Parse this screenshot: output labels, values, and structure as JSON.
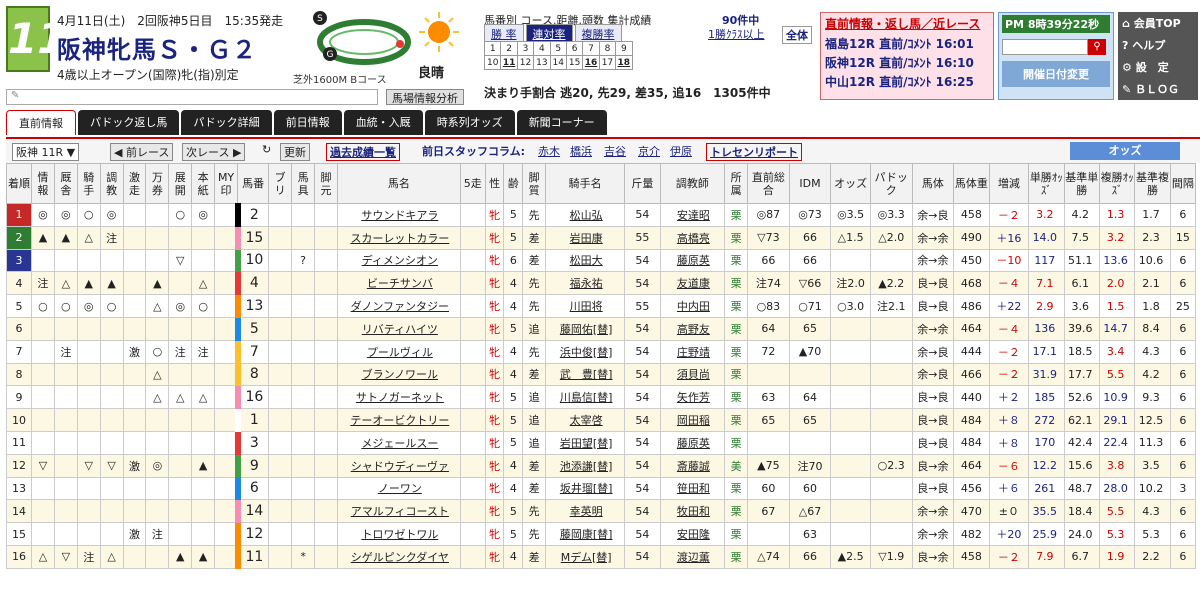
{
  "header": {
    "race_no": "11",
    "date": "4月11日(土)　2回阪神5日目　15:35発走",
    "race_name": "阪神牝馬Ｓ・Ｇ２",
    "condition": "4歳以上オープン(国際)牝(指)別定",
    "course": "芝外1600M",
    "course_sub": "Bコース",
    "weather": "良晴"
  },
  "stats": {
    "label": "馬番別 コース.距離.頭数 集計成績",
    "count": "90件中",
    "tabs": [
      "勝 率",
      "連対率",
      "複勝率"
    ],
    "active_tab": 1,
    "class_link": "1勝ｸﾗｽ以上",
    "all_label": "全体",
    "numbers": [
      "1",
      "2",
      "3",
      "4",
      "5",
      "6",
      "7",
      "8",
      "9",
      "10",
      "11",
      "12",
      "13",
      "14",
      "15",
      "16",
      "17",
      "18"
    ],
    "winning": "決まり手割合 逃20, 先29, 差35, 追16　1305件中"
  },
  "notice": {
    "head": "直前情報・返し馬／近レース",
    "lines": [
      "福島12R 直前/ｺﾒﾝﾄ 16:01",
      "阪神12R 直前/ｺﾒﾝﾄ 16:10",
      "中山12R 直前/ｺﾒﾝﾄ 16:25"
    ]
  },
  "clock": {
    "time": "PM 8時39分22秒",
    "date_btn": "開催日付変更"
  },
  "menu": [
    "会員TOP",
    "ヘルプ",
    "設　定",
    "ＢＬＯＧ"
  ],
  "baba_btn": "馬場情報分析",
  "nav_tabs": [
    "直前情報",
    "パドック返し馬",
    "パドック詳細",
    "前日情報",
    "血統・入厩",
    "時系列オッズ",
    "新聞コーナー"
  ],
  "toolbar": {
    "race_select": "阪神 11R",
    "prev": "前レース",
    "next": "次レース",
    "refresh": "更新",
    "past": "過去成績一覧",
    "staff": "前日スタッフコラム:",
    "staff_names": [
      "赤木",
      "橋浜",
      "吉谷",
      "京介",
      "伊原"
    ],
    "trecen": "トレセンリポート",
    "odds": "オッズ"
  },
  "columns": [
    "着順",
    "情報",
    "厩舎",
    "騎手",
    "調教",
    "激走",
    "万券",
    "展開",
    "本紙",
    "MY印",
    "馬番",
    "ブリ",
    "馬具",
    "脚元",
    "馬名",
    "5走",
    "性",
    "齢",
    "脚質",
    "騎手名",
    "斤量",
    "調教師",
    "所属",
    "直前総合",
    "IDM",
    "オッズ",
    "パドック",
    "馬体",
    "馬体重",
    "増減",
    "単勝ｵｯｽﾞ",
    "基準単勝",
    "複勝ｵｯｽﾞ",
    "基準複勝",
    "間隔"
  ],
  "rows": [
    [
      "1",
      "◎",
      "◎",
      "○",
      "◎",
      "",
      "",
      "○",
      "◎",
      "",
      "2",
      "",
      "",
      "",
      "サウンドキアラ",
      "",
      "牝",
      "5",
      "先",
      "松山弘",
      "54",
      "安達昭",
      "栗",
      "◎87",
      "◎73",
      "◎3.5",
      "◎3.3",
      "余→良",
      "458",
      "－２",
      "3.2",
      "4.2",
      "1.3",
      "1.7",
      "6"
    ],
    [
      "2",
      "▲",
      "▲",
      "△",
      "注",
      "",
      "",
      "",
      "",
      "",
      "15",
      "",
      "",
      "",
      "スカーレットカラー",
      "",
      "牝",
      "5",
      "差",
      "岩田康",
      "55",
      "高橋亮",
      "栗",
      "▽73",
      "66",
      "△1.5",
      "△2.0",
      "余→余",
      "490",
      "＋16",
      "14.0",
      "7.5",
      "3.2",
      "2.3",
      "15"
    ],
    [
      "3",
      "",
      "",
      "",
      "",
      "",
      "",
      "▽",
      "",
      "",
      "10",
      "",
      "?",
      "",
      "ディメンシオン",
      "",
      "牝",
      "6",
      "差",
      "松田大",
      "54",
      "藤原英",
      "栗",
      "66",
      "66",
      "",
      "",
      "余→余",
      "450",
      "－10",
      "117",
      "51.1",
      "13.6",
      "10.6",
      "6"
    ],
    [
      "4",
      "注",
      "△",
      "▲",
      "▲",
      "",
      "▲",
      "",
      "△",
      "",
      "4",
      "",
      "",
      "",
      "ビーチサンバ",
      "",
      "牝",
      "4",
      "先",
      "福永祐",
      "54",
      "友道康",
      "栗",
      "注74",
      "▽66",
      "注2.0",
      "▲2.2",
      "良→良",
      "468",
      "－４",
      "7.1",
      "6.1",
      "2.0",
      "2.1",
      "6"
    ],
    [
      "5",
      "○",
      "○",
      "◎",
      "○",
      "",
      "△",
      "◎",
      "○",
      "",
      "13",
      "",
      "",
      "",
      "ダノンファンタジー",
      "",
      "牝",
      "4",
      "先",
      "川田将",
      "55",
      "中内田",
      "栗",
      "○83",
      "○71",
      "○3.0",
      "注2.1",
      "良→良",
      "486",
      "＋22",
      "2.9",
      "3.6",
      "1.5",
      "1.8",
      "25"
    ],
    [
      "6",
      "",
      "",
      "",
      "",
      "",
      "",
      "",
      "",
      "",
      "5",
      "",
      "",
      "",
      "リバティハイツ",
      "",
      "牝",
      "5",
      "追",
      "藤岡佑[替]",
      "54",
      "高野友",
      "栗",
      "64",
      "65",
      "",
      "",
      "余→余",
      "464",
      "－４",
      "136",
      "39.6",
      "14.7",
      "8.4",
      "6"
    ],
    [
      "7",
      "",
      "注",
      "",
      "",
      "激",
      "○",
      "注",
      "注",
      "",
      "7",
      "",
      "",
      "",
      "プールヴィル",
      "",
      "牝",
      "4",
      "先",
      "浜中俊[替]",
      "54",
      "庄野靖",
      "栗",
      "72",
      "▲70",
      "",
      "",
      "余→良",
      "444",
      "－２",
      "17.1",
      "18.5",
      "3.4",
      "4.3",
      "6"
    ],
    [
      "8",
      "",
      "",
      "",
      "",
      "",
      "△",
      "",
      "",
      "",
      "8",
      "",
      "",
      "",
      "ブランノワール",
      "",
      "牝",
      "4",
      "差",
      "武　豊[替]",
      "54",
      "須貝尚",
      "栗",
      "",
      "",
      "",
      "",
      "余→良",
      "466",
      "－２",
      "31.9",
      "17.7",
      "5.5",
      "4.2",
      "6"
    ],
    [
      "9",
      "",
      "",
      "",
      "",
      "",
      "△",
      "△",
      "△",
      "",
      "16",
      "",
      "",
      "",
      "サトノガーネット",
      "",
      "牝",
      "5",
      "追",
      "川島信[替]",
      "54",
      "矢作芳",
      "栗",
      "63",
      "64",
      "",
      "",
      "良→良",
      "440",
      "＋２",
      "185",
      "52.6",
      "10.9",
      "9.3",
      "6"
    ],
    [
      "10",
      "",
      "",
      "",
      "",
      "",
      "",
      "",
      "",
      "",
      "1",
      "",
      "",
      "",
      "テーオービクトリー",
      "",
      "牝",
      "5",
      "追",
      "太宰啓",
      "54",
      "岡田稲",
      "栗",
      "65",
      "65",
      "",
      "",
      "良→良",
      "484",
      "＋８",
      "272",
      "62.1",
      "29.1",
      "12.5",
      "6"
    ],
    [
      "11",
      "",
      "",
      "",
      "",
      "",
      "",
      "",
      "",
      "",
      "3",
      "",
      "",
      "",
      "メジェールスー",
      "",
      "牝",
      "5",
      "追",
      "岩田望[替]",
      "54",
      "藤原英",
      "栗",
      "",
      "",
      "",
      "",
      "良→良",
      "484",
      "＋８",
      "170",
      "42.4",
      "22.4",
      "11.3",
      "6"
    ],
    [
      "12",
      "▽",
      "",
      "▽",
      "▽",
      "激",
      "◎",
      "",
      "▲",
      "",
      "9",
      "",
      "",
      "",
      "シャドウディーヴァ",
      "",
      "牝",
      "4",
      "差",
      "池添謙[替]",
      "54",
      "斎藤誠",
      "美",
      "▲75",
      "注70",
      "",
      "○2.3",
      "良→余",
      "464",
      "－６",
      "12.2",
      "15.6",
      "3.8",
      "3.5",
      "6"
    ],
    [
      "13",
      "",
      "",
      "",
      "",
      "",
      "",
      "",
      "",
      "",
      "6",
      "",
      "",
      "",
      "ノーワン",
      "",
      "牝",
      "4",
      "差",
      "坂井瑠[替]",
      "54",
      "笹田和",
      "栗",
      "60",
      "60",
      "",
      "",
      "良→良",
      "456",
      "＋６",
      "261",
      "48.7",
      "28.0",
      "10.2",
      "3"
    ],
    [
      "14",
      "",
      "",
      "",
      "",
      "",
      "",
      "",
      "",
      "",
      "14",
      "",
      "",
      "",
      "アマルフィコースト",
      "",
      "牝",
      "5",
      "先",
      "幸英明",
      "54",
      "牧田和",
      "栗",
      "67",
      "△67",
      "",
      "",
      "余→余",
      "470",
      "±０",
      "35.5",
      "18.4",
      "5.5",
      "4.3",
      "6"
    ],
    [
      "15",
      "",
      "",
      "",
      "",
      "激",
      "注",
      "",
      "",
      "",
      "12",
      "",
      "",
      "",
      "トロワゼトワル",
      "",
      "牝",
      "5",
      "先",
      "藤岡康[替]",
      "54",
      "安田隆",
      "栗",
      "",
      "63",
      "",
      "",
      "余→余",
      "482",
      "＋20",
      "25.9",
      "24.0",
      "5.3",
      "5.3",
      "6"
    ],
    [
      "16",
      "△",
      "▽",
      "注",
      "△",
      "",
      "",
      "▲",
      "▲",
      "",
      "11",
      "",
      "*",
      "",
      "シゲルピンクダイヤ",
      "",
      "牝",
      "4",
      "差",
      "Mデム[替]",
      "54",
      "渡辺薫",
      "栗",
      "△74",
      "66",
      "▲2.5",
      "▽1.9",
      "良→余",
      "458",
      "－２",
      "7.9",
      "6.7",
      "1.9",
      "2.2",
      "6"
    ]
  ],
  "colors": {
    "accent": "#c62828",
    "waku": [
      "#ffffff",
      "#ffffff",
      "#000000",
      "#e53935",
      "#1e88e5",
      "#fbc02d",
      "#43a047",
      "#fb8c00",
      "#f48fb1"
    ]
  }
}
